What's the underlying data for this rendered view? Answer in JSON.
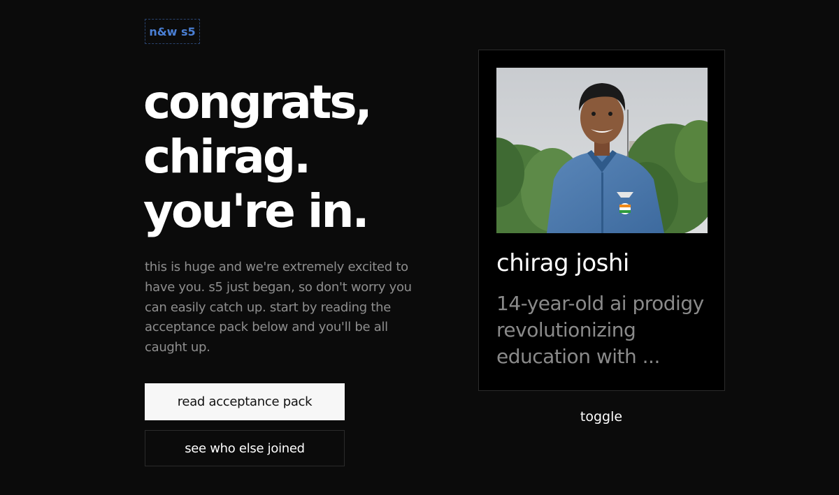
{
  "tag": "n&w s5",
  "headline": {
    "line1": "congrats,",
    "line2": "chirag.",
    "line3": "you're in."
  },
  "body_text": "this is huge and we're extremely excited to have you. s5 just began, so don't worry you can easily catch up. start by reading the acceptance pack below and you'll be all caught up.",
  "buttons": {
    "primary": "read acceptance pack",
    "secondary": "see who else joined"
  },
  "card": {
    "name": "chirag joshi",
    "description": "14-year-old ai prodigy revolutionizing education with ..."
  },
  "toggle": "toggle",
  "colors": {
    "background": "#0b0b0b",
    "tag_accent": "#4a7fd4",
    "muted_text": "#8e8e8e",
    "card_bg": "#000000"
  }
}
